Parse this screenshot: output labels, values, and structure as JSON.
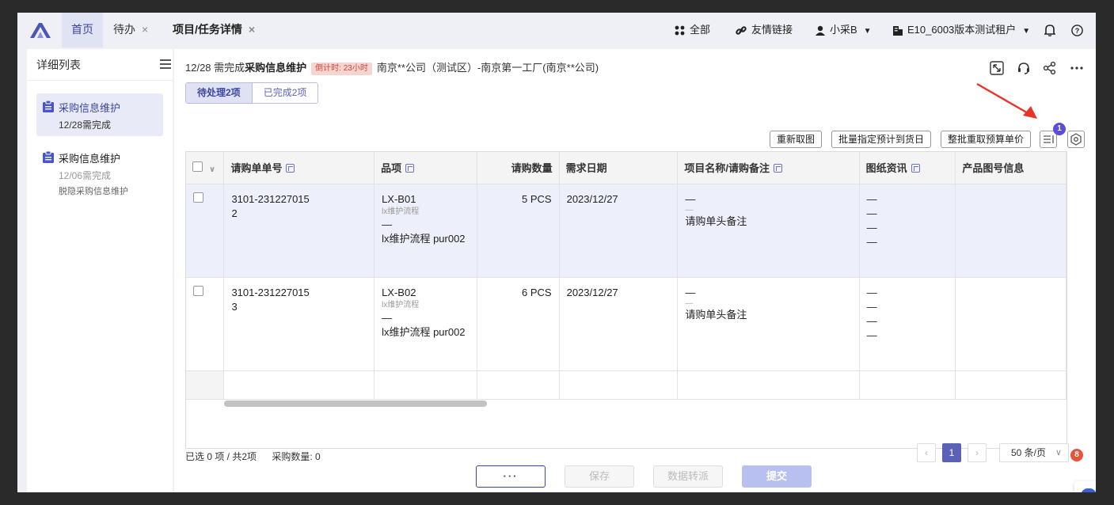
{
  "topbar": {
    "tabs": [
      {
        "label": "首页"
      },
      {
        "label": "待办",
        "close": "×"
      },
      {
        "label": "项目/任务详情",
        "close": "×"
      }
    ],
    "all_label": "全部",
    "links_label": "友情链接",
    "user_label": "小采B",
    "tenant_label": "E10_6003版本测试租户"
  },
  "sidebar": {
    "title": "详细列表",
    "items": [
      {
        "title": "采购信息维护",
        "date": "12/28需完成",
        "note": ""
      },
      {
        "title": "采购信息维护",
        "date": "12/06需完成",
        "note": "脱隐采购信息维护"
      }
    ]
  },
  "header": {
    "prefix": "12/28 需完成",
    "title": "采购信息维护",
    "countdown": "倒计时: 23小时",
    "org": "南京**公司（测试区）-南京第一工厂(南京**公司)"
  },
  "tabs": {
    "pending": "待处理2项",
    "done": "已完成2项"
  },
  "toolbar": {
    "btn1": "重新取图",
    "btn2": "批量指定预计到货日",
    "btn3": "整批重取预算单价",
    "notif_count": "1"
  },
  "table": {
    "columns": [
      "请购单单号",
      "品项",
      "请购数量",
      "需求日期",
      "项目名称/请购备注",
      "图纸资讯",
      "产品图号信息"
    ],
    "rows": [
      {
        "order": "3101-231227015",
        "order2": "2",
        "item": "LX-B01",
        "item_sub": "lx维护流程",
        "item_dash": "—",
        "item_desc": "lx维护流程 pur002",
        "qty": "5 PCS",
        "date": "2023/12/27",
        "proj": "—",
        "proj_dash": "—",
        "remark": "请购单头备注",
        "draw": [
          "—",
          "—",
          "—",
          "—"
        ]
      },
      {
        "order": "3101-231227015",
        "order2": "3",
        "item": "LX-B02",
        "item_sub": "lx维护流程",
        "item_dash": "—",
        "item_desc": "lx维护流程 pur002",
        "qty": "6 PCS",
        "date": "2023/12/27",
        "proj": "—",
        "proj_dash": "—",
        "remark": "请购单头备注",
        "draw": [
          "—",
          "—",
          "—",
          "—"
        ]
      }
    ]
  },
  "footer": {
    "selected": "已选 0 项 / 共2项",
    "purchase_qty": "采购数量: 0",
    "page": "1",
    "page_size": "50 条/页"
  },
  "actions": {
    "more": "···",
    "save": "保存",
    "transfer": "数据转派",
    "submit": "提交"
  },
  "chat": {
    "badge": "8"
  },
  "colors": {
    "accent": "#3d46a3",
    "badge": "#5b4ce0",
    "countdown_bg": "#f6d5d0",
    "countdown_text": "#d4453a",
    "arrow": "#e8352b"
  }
}
